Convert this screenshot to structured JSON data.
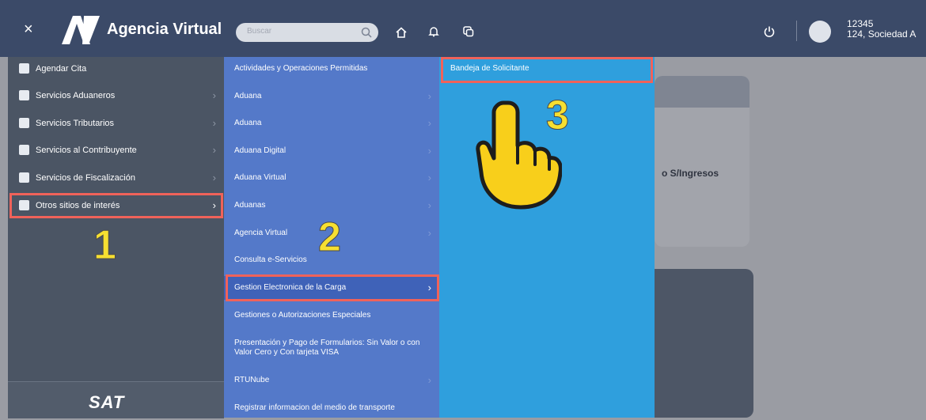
{
  "header": {
    "close": "×",
    "logo": "AV",
    "title": "Agencia Virtual",
    "search_placeholder": "Buscar",
    "user_line1": "12345",
    "user_line2": "124, Sociedad A"
  },
  "sidebar": {
    "items": [
      {
        "label": "Agendar Cita",
        "icon": "calendar-icon"
      },
      {
        "label": "Servicios Aduaneros",
        "icon": "customs-icon"
      },
      {
        "label": "Servicios Tributarios",
        "icon": "tax-icon"
      },
      {
        "label": "Servicios al Contribuyente",
        "icon": "document-icon"
      },
      {
        "label": "Servicios de Fiscalización",
        "icon": "audit-icon"
      },
      {
        "label": "Otros sitios de interés",
        "icon": "external-sites-icon"
      }
    ],
    "footer_logo": "SAT"
  },
  "submenu": {
    "items": [
      "Actividades y Operaciones Permitidas",
      "Aduana",
      "Aduana",
      "Aduana Digital",
      "Aduana Virtual",
      "Aduanas",
      "Agencia Virtual",
      "Consulta e-Servicios",
      "Gestion Electronica de la Carga",
      "Gestiones o Autorizaciones Especiales",
      "Presentación y Pago de Formularios: Sin Valor o con Valor Cero y Con tarjeta VISA",
      "RTUNube",
      "Registrar informacion del medio de transporte"
    ]
  },
  "submenu2": {
    "items": [
      "Bandeja de Solicitante"
    ]
  },
  "background": {
    "card_text": "o S/Ingresos"
  },
  "annotations": {
    "step1": "1",
    "step2": "2",
    "step3": "3",
    "highlight_color": "#f0625a",
    "number_color": "#f6df31"
  }
}
